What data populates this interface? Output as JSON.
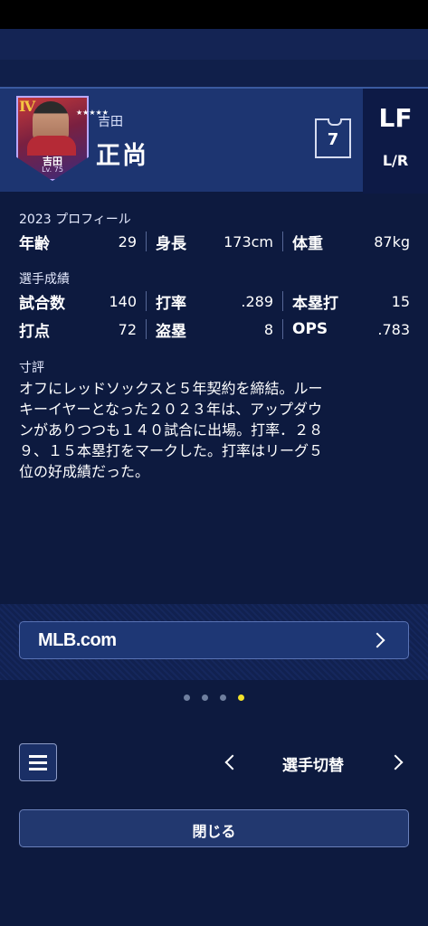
{
  "player": {
    "surname": "吉田",
    "given_name": "正尚",
    "number": "7",
    "position": "LF",
    "bats_throws": "L/R",
    "card": {
      "grade": "Ⅳ",
      "name": "吉田",
      "level": "Lv. 75",
      "stars": "★★★★★"
    }
  },
  "profile": {
    "label": "2023 プロフィール",
    "items": [
      {
        "key": "年齢",
        "value": "29"
      },
      {
        "key": "身長",
        "value": "173cm"
      },
      {
        "key": "体重",
        "value": "87kg"
      }
    ]
  },
  "stats": {
    "label": "選手成績",
    "row1": [
      {
        "key": "試合数",
        "value": "140"
      },
      {
        "key": "打率",
        "value": ".289"
      },
      {
        "key": "本塁打",
        "value": "15"
      }
    ],
    "row2": [
      {
        "key": "打点",
        "value": "72"
      },
      {
        "key": "盗塁",
        "value": "8"
      },
      {
        "key": "OPS",
        "value": ".783"
      }
    ]
  },
  "comment": {
    "label": "寸評",
    "lines": [
      "オフにレッドソックスと５年契約を締結。ルー",
      "キーイヤーとなった２０２３年は、アップダウ",
      "ンがありつつも１４０試合に出場。打率．２８",
      "９、１５本塁打をマークした。打率はリーグ５",
      "位の好成績だった。"
    ]
  },
  "links": {
    "mlb_label": "MLB.com"
  },
  "pagination": {
    "total": 4,
    "active_index": 3
  },
  "footer": {
    "switch_label": "選手切替",
    "close_label": "閉じる"
  },
  "colors": {
    "background": "#0d1a3f",
    "header": "#1d3571",
    "active_dot": "#f2e12a"
  }
}
